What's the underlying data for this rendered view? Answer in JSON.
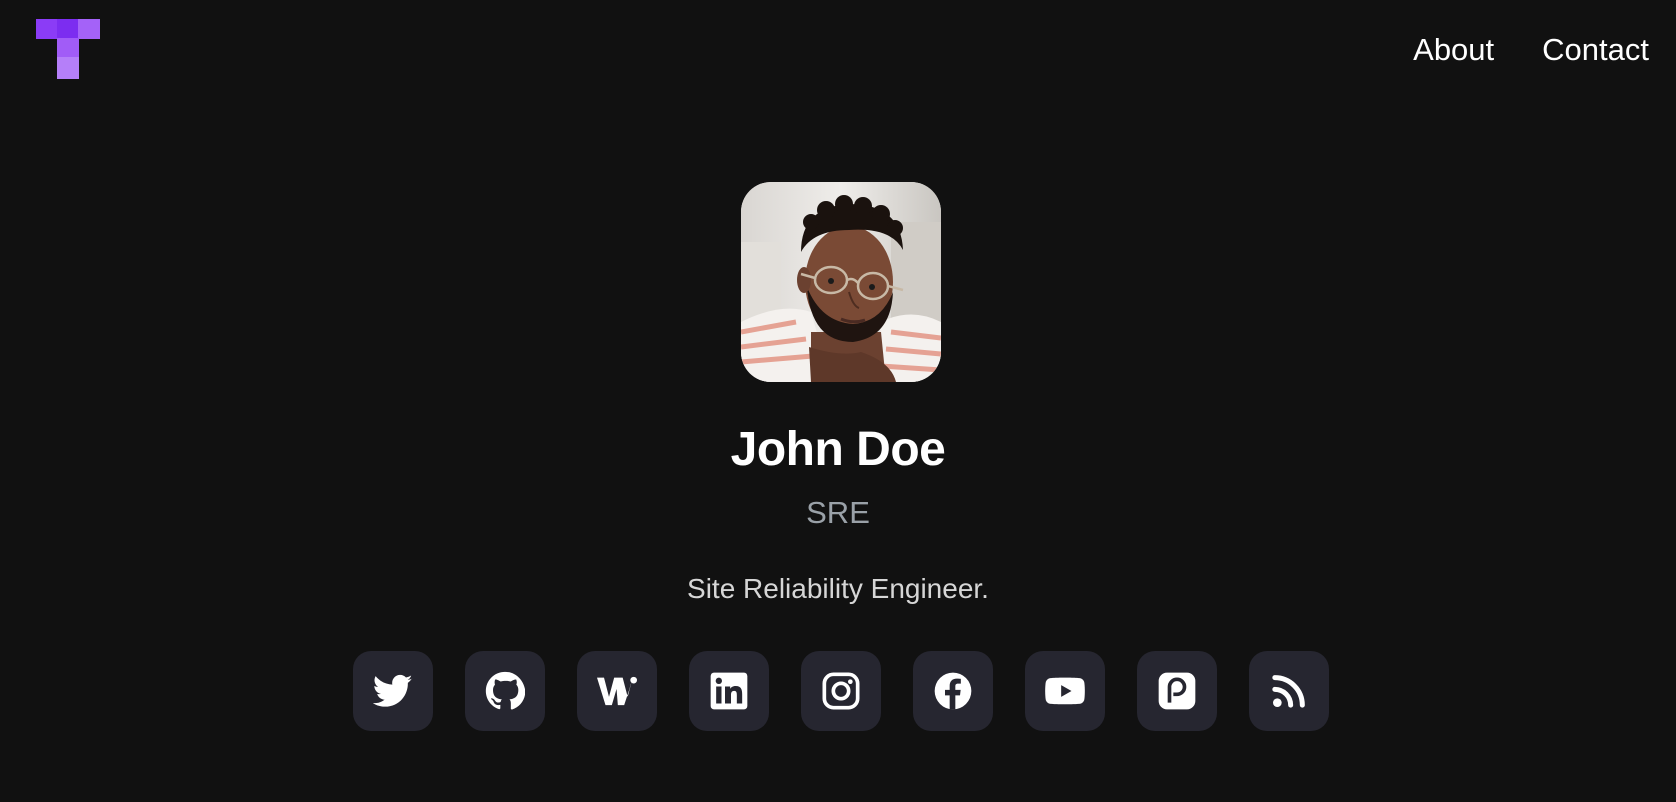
{
  "header": {
    "logo_icon": "t-logo-icon",
    "nav": [
      {
        "label": "About"
      },
      {
        "label": "Contact"
      }
    ]
  },
  "profile": {
    "name": "John Doe",
    "role": "SRE",
    "bio": "Site Reliability Engineer."
  },
  "socials": [
    {
      "icon": "twitter-icon"
    },
    {
      "icon": "github-icon"
    },
    {
      "icon": "wellfound-icon"
    },
    {
      "icon": "linkedin-icon"
    },
    {
      "icon": "instagram-icon"
    },
    {
      "icon": "facebook-icon"
    },
    {
      "icon": "youtube-icon"
    },
    {
      "icon": "patreon-icon"
    },
    {
      "icon": "rss-icon"
    }
  ],
  "colors": {
    "background": "#111111",
    "logo_purple": "#a855f7",
    "social_bg": "#262630",
    "role_text": "#9aa1a8"
  }
}
